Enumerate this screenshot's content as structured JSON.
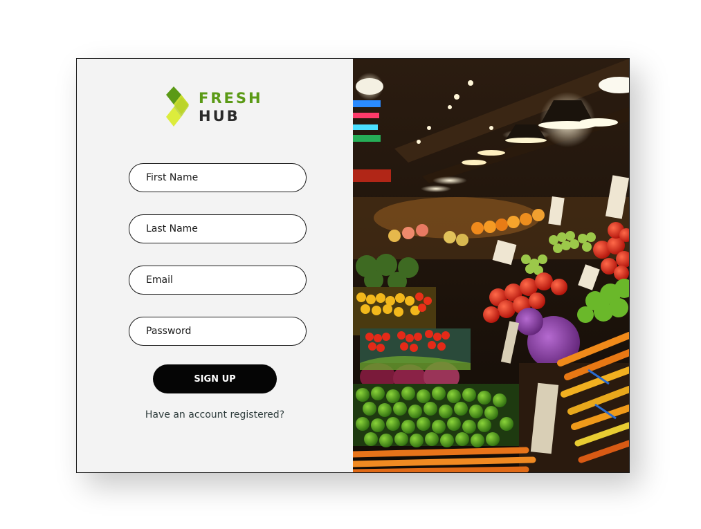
{
  "brand": {
    "line1": "FRESH",
    "line2": "HUB",
    "icon": "leaf-logo-icon",
    "colors": {
      "fresh": "#5b9a16",
      "hub": "#2a2a2a",
      "leaf_dark": "#5b9a16",
      "leaf_light": "#c8dc2a"
    }
  },
  "form": {
    "first_name": {
      "placeholder": "First Name",
      "value": ""
    },
    "last_name": {
      "placeholder": "Last Name",
      "value": ""
    },
    "email": {
      "placeholder": "Email",
      "value": ""
    },
    "password": {
      "placeholder": "Password",
      "value": ""
    },
    "submit_label": "SIGN UP",
    "login_link": "Have an account registered?"
  },
  "hero_image": {
    "subject": "farmers market produce stall",
    "icon": "produce-market-photo"
  },
  "colors": {
    "panel_bg": "#f3f3f3",
    "button_bg": "#050505",
    "button_text": "#ffffff",
    "link_text": "#2d3b3b"
  }
}
